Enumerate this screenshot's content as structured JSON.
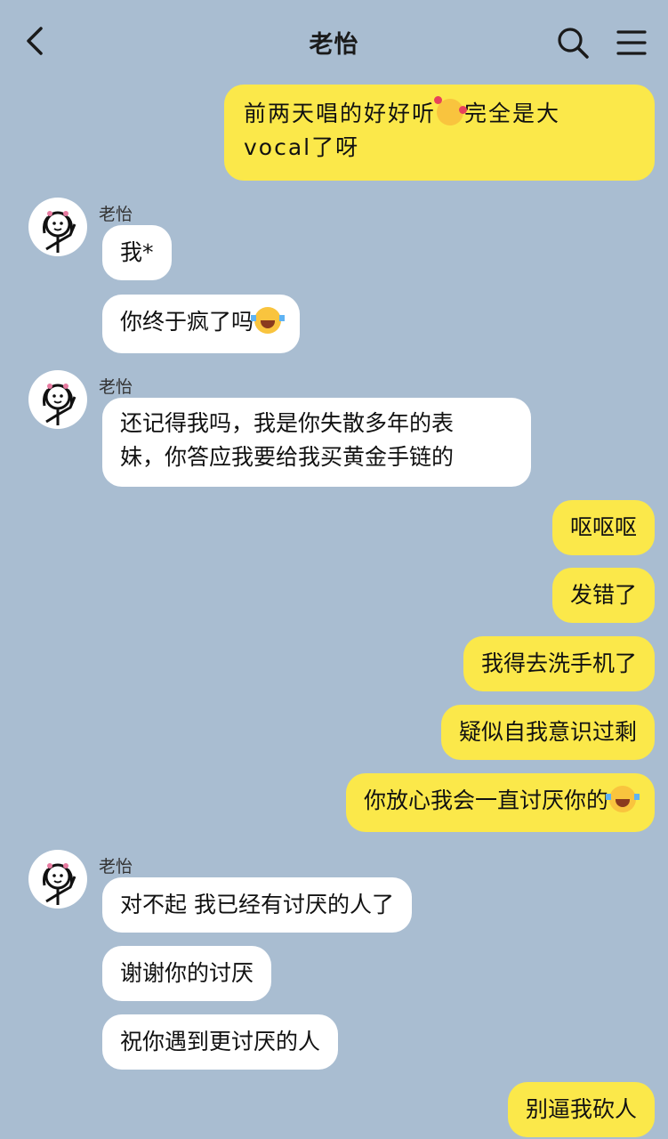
{
  "header": {
    "title": "老怡",
    "back_icon": "chevron-left-icon",
    "search_icon": "search-icon",
    "menu_icon": "hamburger-menu-icon"
  },
  "colors": {
    "background": "#a9bdd1",
    "incoming_bubble": "#ffffff",
    "outgoing_bubble": "#fbe84a"
  },
  "messages": {
    "m1": {
      "line1_pre": "前两天唱的好好听",
      "line1_emoji": "smiling-face-with-hearts-emoji",
      "line1_post": "完全是大",
      "line2": "vocal了呀"
    },
    "g1": {
      "sender": "老怡",
      "m2": "我*",
      "m3": "你终于疯了吗",
      "m3_emoji": "laughing-tears-emoji"
    },
    "g2": {
      "sender": "老怡",
      "m4_line1": "还记得我吗，我是你失散多年的表",
      "m4_line2": "妹，你答应我要给我买黄金手链的"
    },
    "m5": "呕呕呕",
    "m6": "发错了",
    "m7": "我得去洗手机了",
    "m8": "疑似自我意识过剩",
    "m9": "你放心我会一直讨厌你的",
    "m9_emoji": "laughing-tears-emoji",
    "g3": {
      "sender": "老怡",
      "m10": "对不起 我已经有讨厌的人了",
      "m11": "谢谢你的讨厌",
      "m12": "祝你遇到更讨厌的人"
    },
    "m13": "别逼我砍人"
  }
}
